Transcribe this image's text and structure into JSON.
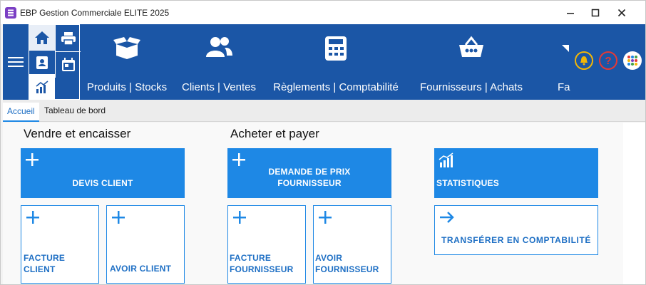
{
  "window": {
    "title": "EBP Gestion Commerciale ELITE 2025",
    "controls": [
      "minimize",
      "maximize",
      "close"
    ]
  },
  "ribbon": {
    "quick_access": [
      {
        "icon": "home-icon"
      },
      {
        "icon": "print-icon"
      },
      {
        "icon": "contacts-book-icon"
      },
      {
        "icon": "bar-chart-icon"
      },
      {
        "icon": "calendar-icon"
      }
    ],
    "modules": [
      {
        "label": "Produits | Stocks",
        "icon": "open-box-icon"
      },
      {
        "label": "Clients | Ventes",
        "icon": "users-icon"
      },
      {
        "label": "Règlements | Comptabilité",
        "icon": "calculator-icon"
      },
      {
        "label": "Fournisseurs | Achats",
        "icon": "basket-icon"
      },
      {
        "label": "Fa",
        "icon": "flag-icon"
      }
    ],
    "right_icons": [
      "bell-icon",
      "help-icon",
      "apps-grid-icon"
    ]
  },
  "tabs": [
    {
      "label": "Accueil",
      "active": true
    },
    {
      "label": "Tableau de bord",
      "active": false
    }
  ],
  "sections": {
    "sell": {
      "title": "Vendre et encaisser",
      "primary": {
        "label": "DEVIS CLIENT",
        "icon": "plus-icon"
      },
      "secondary": [
        {
          "label_line1": "FACTURE",
          "label_line2": "CLIENT",
          "icon": "plus-icon"
        },
        {
          "label_line1": "AVOIR CLIENT",
          "label_line2": "",
          "icon": "plus-icon"
        }
      ]
    },
    "buy": {
      "title": "Acheter et payer",
      "primary": {
        "label_line1": "DEMANDE DE PRIX",
        "label_line2": "FOURNISSEUR",
        "icon": "plus-icon"
      },
      "secondary": [
        {
          "label_line1": "FACTURE",
          "label_line2": "FOURNISSEUR",
          "icon": "plus-icon"
        },
        {
          "label_line1": "AVOIR",
          "label_line2": "FOURNISSEUR",
          "icon": "plus-icon"
        }
      ]
    },
    "other": {
      "primary": {
        "label": "STATISTIQUES",
        "icon": "stats-icon"
      },
      "secondary": {
        "label": "TRANSFÉRER EN COMPTABILITÉ",
        "icon": "arrow-right-icon"
      }
    }
  },
  "colors": {
    "ribbon": "#1b56a6",
    "accent": "#1e88e5",
    "bell": "#f2b705",
    "help": "#e53935"
  }
}
